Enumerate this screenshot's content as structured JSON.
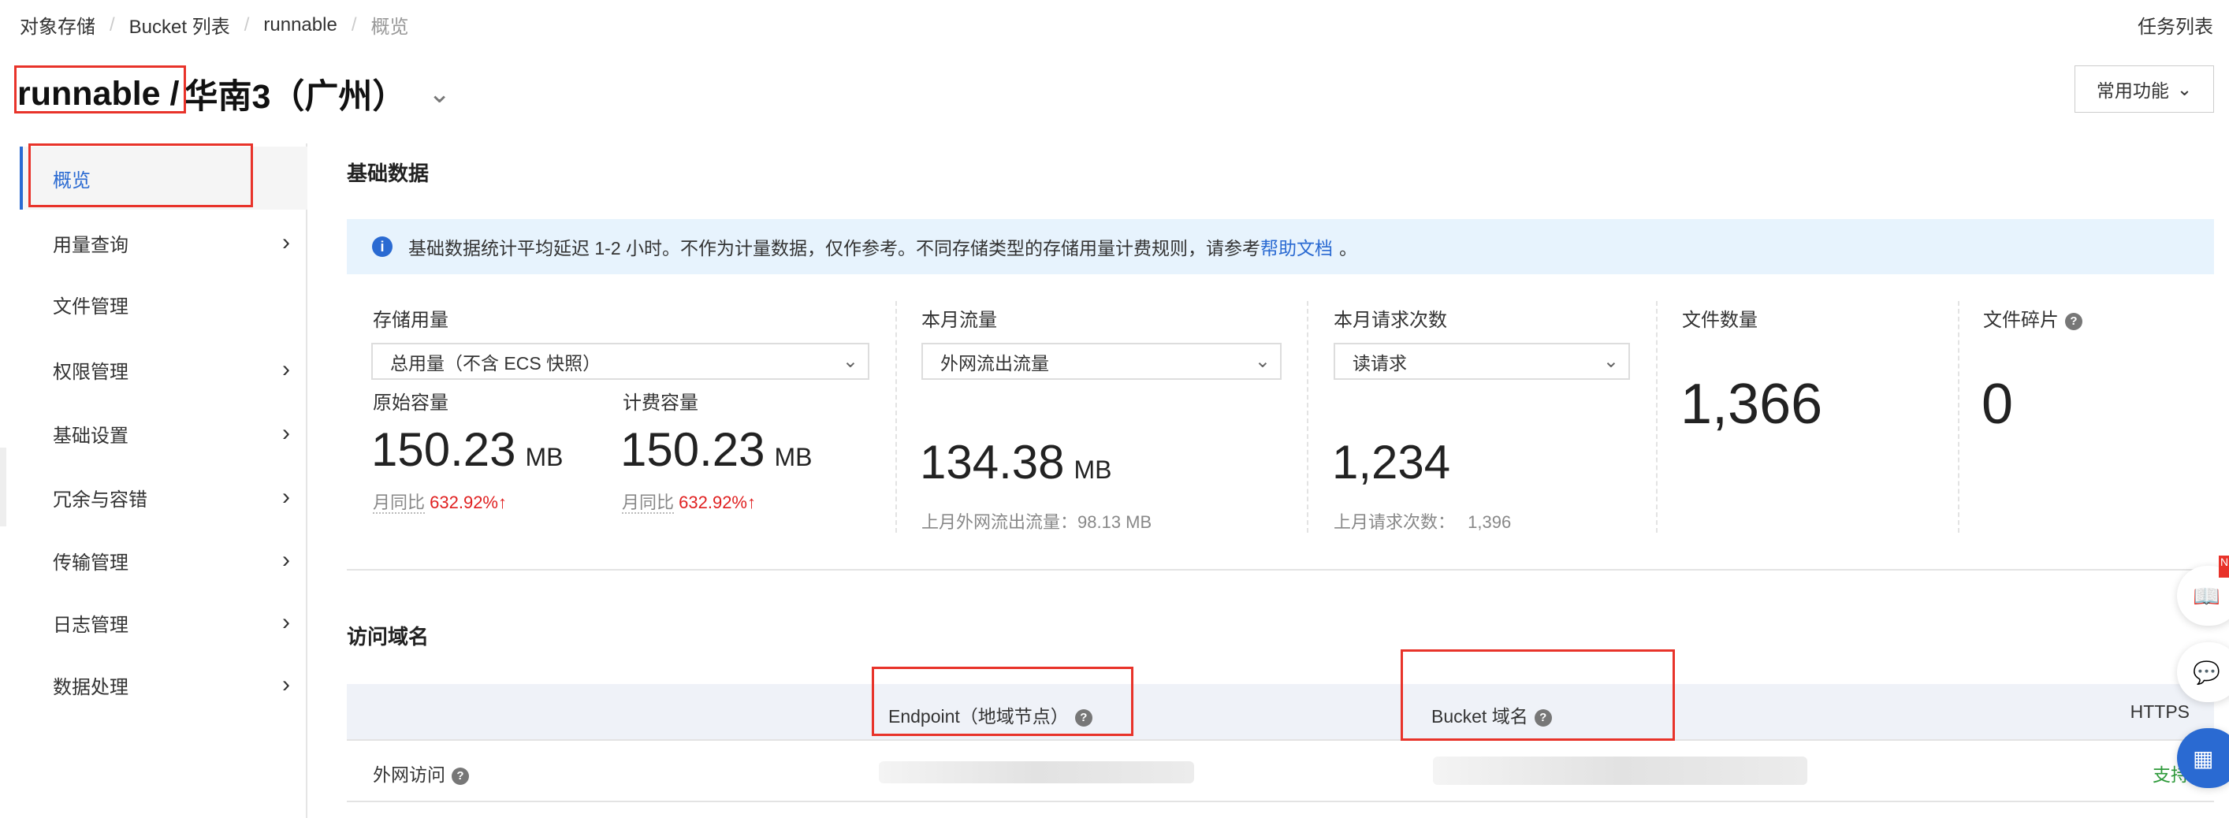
{
  "breadcrumb": [
    "对象存储",
    "Bucket 列表",
    "runnable",
    "概览"
  ],
  "task_list": "任务列表",
  "title": {
    "bucket": "runnable /",
    "region": "华南3（广州）"
  },
  "common_functions": "常用功能",
  "sidebar": {
    "items": [
      {
        "label": "概览"
      },
      {
        "label": "用量查询"
      },
      {
        "label": "文件管理"
      },
      {
        "label": "权限管理"
      },
      {
        "label": "基础设置"
      },
      {
        "label": "冗余与容错"
      },
      {
        "label": "传输管理"
      },
      {
        "label": "日志管理"
      },
      {
        "label": "数据处理"
      }
    ]
  },
  "basic": {
    "heading": "基础数据",
    "notice": "基础数据统计平均延迟 1-2 小时。不作为计量数据，仅作参考。不同存储类型的存储用量计费规则，请参考",
    "notice_link": "帮助文档",
    "notice_end": "。",
    "storage": {
      "label": "存储用量",
      "select": "总用量（不含 ECS 快照）",
      "raw_label": "原始容量",
      "raw_value": "150.23",
      "raw_unit": "MB",
      "bill_label": "计费容量",
      "bill_value": "150.23",
      "bill_unit": "MB",
      "mom_label": "月同比",
      "raw_change": "632.92%",
      "bill_change": "632.92%"
    },
    "traffic": {
      "label": "本月流量",
      "select": "外网流出流量",
      "value": "134.38",
      "unit": "MB",
      "last": "上月外网流出流量：98.13 MB"
    },
    "requests": {
      "label": "本月请求次数",
      "select": "读请求",
      "value": "1,234",
      "last_label": "上月请求次数：",
      "last_value": "1,396"
    },
    "files": {
      "label": "文件数量",
      "value": "1,366"
    },
    "fragments": {
      "label": "文件碎片",
      "value": "0"
    }
  },
  "access": {
    "heading": "访问域名",
    "columns": [
      "Endpoint（地域节点）",
      "Bucket 域名",
      "HTTPS"
    ],
    "rows": [
      {
        "label": "外网访问",
        "https": "支持"
      }
    ]
  },
  "float_badge": "N",
  "colors": {
    "accent": "#2a6ad2",
    "red": "#e02020",
    "annotation": "#e8332a",
    "green": "#2e9a3a"
  }
}
